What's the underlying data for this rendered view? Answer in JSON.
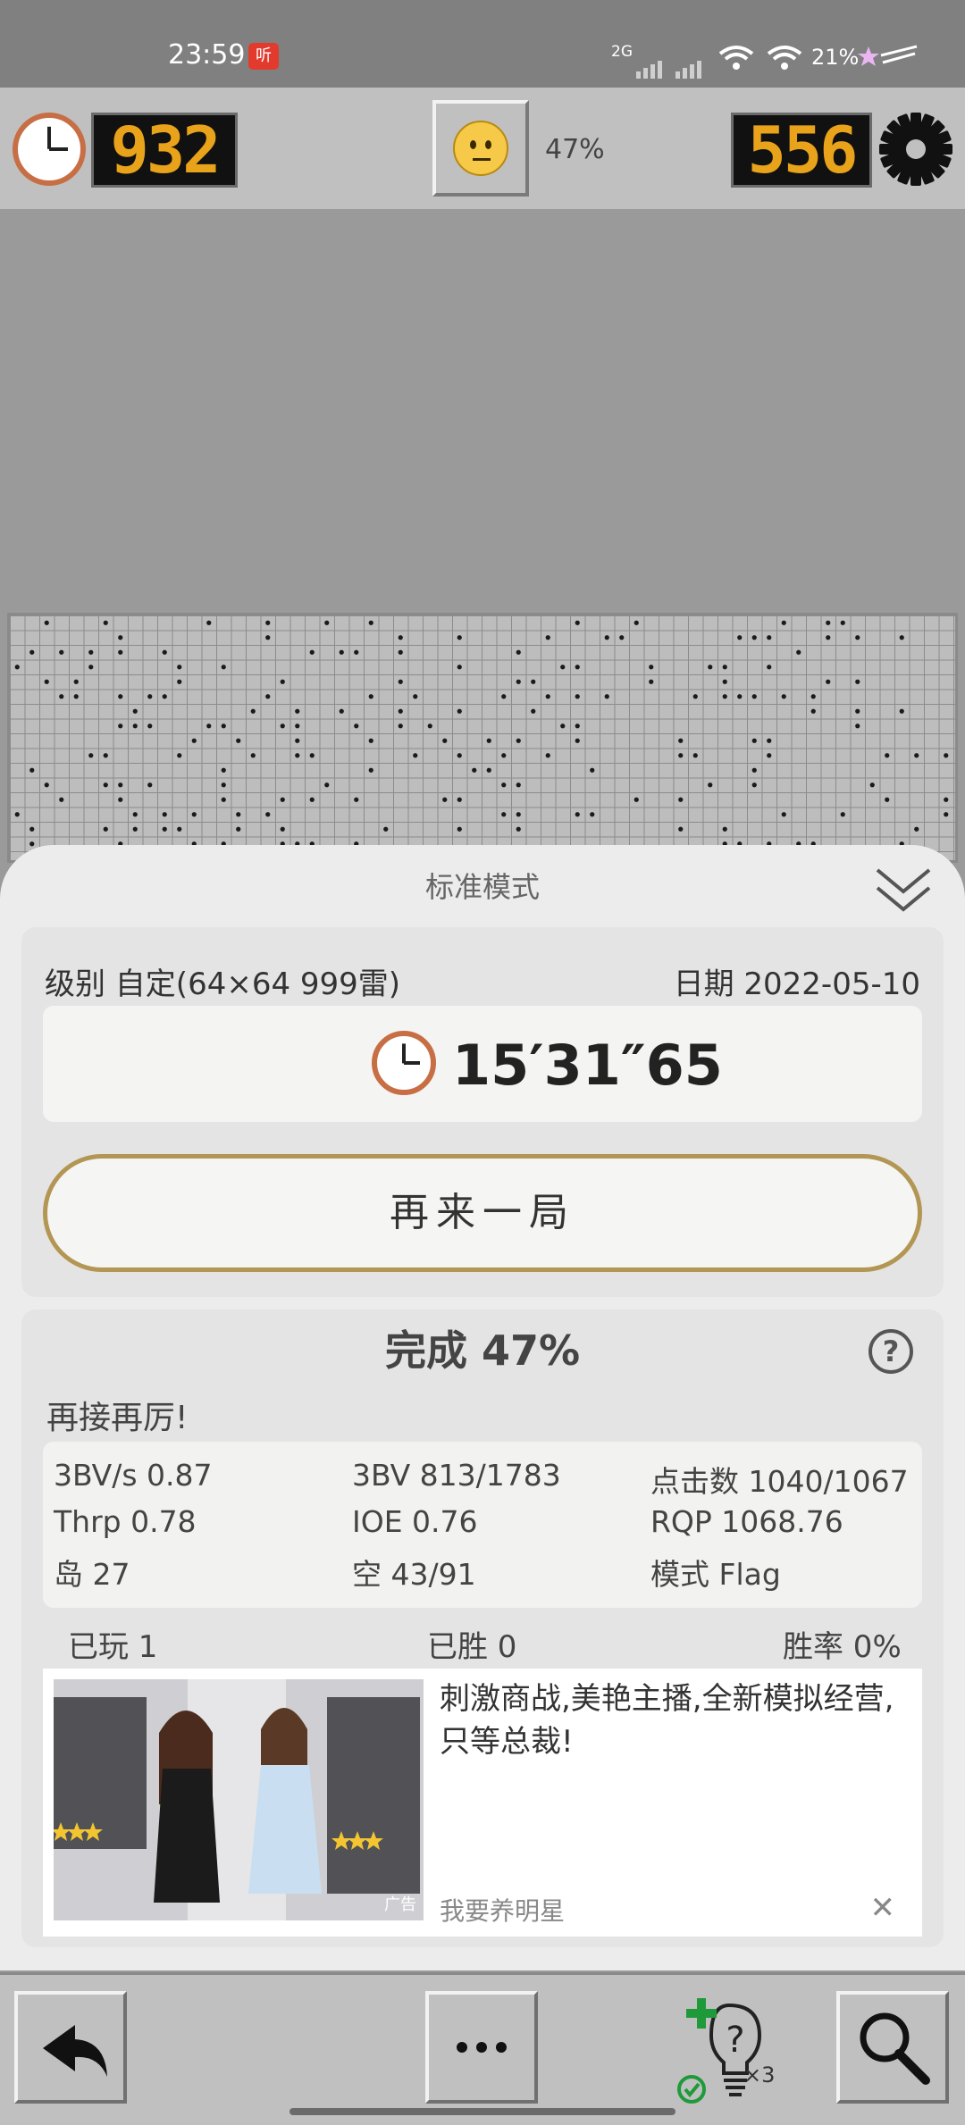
{
  "status_bar": {
    "time": "23:59",
    "badge": "听",
    "network": "2G",
    "battery": "21%"
  },
  "top_bar": {
    "timer_value": "932",
    "mine_counter": "556",
    "progress_percent": "47%"
  },
  "result_sheet": {
    "title": "标准模式",
    "level": "级别 自定(64×64 999雷)",
    "date": "日期 2022-05-10",
    "time": "15′31″65",
    "replay_button": "再来一局",
    "complete_title": "完成 47%",
    "encouragement": "再接再厉!",
    "stats": [
      {
        "label": "3BV/s 0.87"
      },
      {
        "label": "3BV 813/1783"
      },
      {
        "label": "点击数 1040/1067"
      },
      {
        "label": "Thrp 0.78"
      },
      {
        "label": "IOE 0.76"
      },
      {
        "label": "RQP 1068.76"
      },
      {
        "label": "岛 27"
      },
      {
        "label": "空 43/91"
      },
      {
        "label": "模式 Flag"
      }
    ],
    "summary": {
      "played": "已玩 1",
      "won": "已胜 0",
      "win_rate": "胜率 0%"
    },
    "ad": {
      "text": "刺激商战,美艳主播,全新模拟经营,只等总裁!",
      "source": "我要养明星",
      "tag": "广告",
      "close": "✕"
    }
  },
  "toolbar": {
    "hint_count": "×3"
  },
  "colors": {
    "counter_digit": "#e9a31a",
    "replay_border": "#b39653",
    "board_bg": "#bdbdbd"
  }
}
